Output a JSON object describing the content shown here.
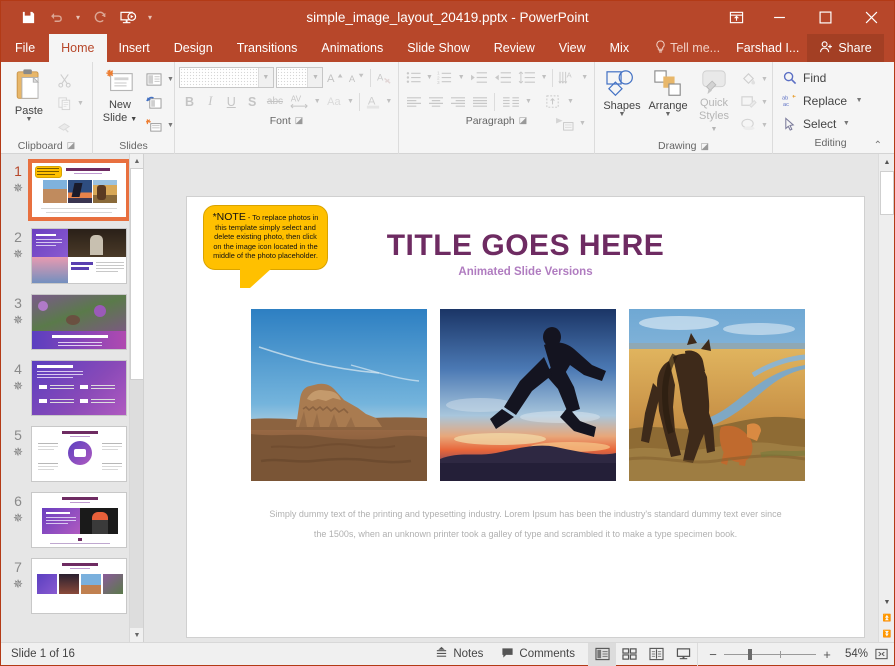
{
  "titlebar": {
    "document_name": "simple_image_layout_20419.pptx - PowerPoint",
    "qat": [
      {
        "name": "save",
        "icon": "save-icon",
        "enabled": true
      },
      {
        "name": "undo",
        "icon": "undo-icon",
        "enabled": false
      },
      {
        "name": "redo",
        "icon": "redo-icon",
        "enabled": false
      },
      {
        "name": "start-presentation",
        "icon": "present-icon",
        "enabled": true
      },
      {
        "name": "customize-qat",
        "icon": "chevron-down-icon",
        "enabled": true
      }
    ],
    "window": {
      "ribbon_display_options": "ribbon-options-icon",
      "minimize": "minimize-icon",
      "maximize": "maximize-icon",
      "close": "close-icon"
    }
  },
  "tabs": [
    {
      "label": "File",
      "active": false
    },
    {
      "label": "Home",
      "active": true
    },
    {
      "label": "Insert",
      "active": false
    },
    {
      "label": "Design",
      "active": false
    },
    {
      "label": "Transitions",
      "active": false
    },
    {
      "label": "Animations",
      "active": false
    },
    {
      "label": "Slide Show",
      "active": false
    },
    {
      "label": "Review",
      "active": false
    },
    {
      "label": "View",
      "active": false
    },
    {
      "label": "Mix",
      "active": false
    }
  ],
  "tellme": "Tell me...",
  "username": "Farshad I...",
  "share": "Share",
  "ribbon": {
    "groups": [
      {
        "name": "Clipboard",
        "has_dialog_launcher": true
      },
      {
        "name": "Slides",
        "has_dialog_launcher": false
      },
      {
        "name": "Font",
        "has_dialog_launcher": true
      },
      {
        "name": "Paragraph",
        "has_dialog_launcher": true
      },
      {
        "name": "Drawing",
        "has_dialog_launcher": true
      },
      {
        "name": "Editing",
        "has_dialog_launcher": false
      }
    ],
    "clipboard": {
      "paste": "Paste",
      "cut_tooltip": "Cut",
      "copy_tooltip": "Copy",
      "format_painter_tooltip": "Format Painter"
    },
    "slides": {
      "new_slide": "New\nSlide",
      "new_slide_line1": "New",
      "new_slide_line2": "Slide",
      "layout_tooltip": "Layout",
      "reset_tooltip": "Reset",
      "section_tooltip": "Section"
    },
    "font": {
      "font_family_value": "",
      "font_size_value": "",
      "bold": "B",
      "italic": "I",
      "underline": "U",
      "shadow": "S",
      "strikethrough": "abc",
      "character_spacing": "AV",
      "change_case": "Aa",
      "font_color": "A",
      "increase_size": "A",
      "decrease_size": "A",
      "clear_formatting_tooltip": "Clear All Formatting"
    },
    "paragraph": {
      "bullets_tooltip": "Bullets",
      "numbering_tooltip": "Numbering",
      "decrease_indent_tooltip": "Decrease List Level",
      "increase_indent_tooltip": "Increase List Level",
      "line_spacing_tooltip": "Line Spacing",
      "text_direction_tooltip": "Text Direction",
      "align_text_tooltip": "Align Text",
      "smartart_tooltip": "Convert to SmartArt",
      "align_left_tooltip": "Align Left",
      "center_tooltip": "Center",
      "align_right_tooltip": "Align Right",
      "justify_tooltip": "Justify",
      "columns_tooltip": "Columns"
    },
    "drawing": {
      "shapes": "Shapes",
      "arrange": "Arrange",
      "quick_styles_line1": "Quick",
      "quick_styles_line2": "Styles",
      "shape_fill_tooltip": "Shape Fill",
      "shape_outline_tooltip": "Shape Outline",
      "shape_effects_tooltip": "Shape Effects"
    },
    "editing": {
      "find": "Find",
      "replace": "Replace",
      "select": "Select"
    },
    "collapse_ribbon": "collapse-ribbon-icon"
  },
  "slide_panel": {
    "slides": [
      {
        "number": "1",
        "active": true,
        "has_animation": true
      },
      {
        "number": "2",
        "active": false,
        "has_animation": true
      },
      {
        "number": "3",
        "active": false,
        "has_animation": true
      },
      {
        "number": "4",
        "active": false,
        "has_animation": true
      },
      {
        "number": "5",
        "active": false,
        "has_animation": true
      },
      {
        "number": "6",
        "active": false,
        "has_animation": true
      },
      {
        "number": "7",
        "active": false,
        "has_animation": true
      }
    ]
  },
  "slide": {
    "note": {
      "heading": "*NOTE",
      "body": " - To replace photos in this template simply select and delete existing photo, then click on the image icon located in the middle of the photo placeholder."
    },
    "title": "TITLE GOES HERE",
    "subtitle": "Animated Slide Versions",
    "body": "Simply dummy text of the printing and typesetting industry. Lorem Ipsum has been the industry's standard dummy text ever since the 1500s, when an unknown printer took a galley of type and scrambled it to make a type specimen book.",
    "photos": [
      {
        "name": "desert-butte-photo",
        "alt": "Desert butte under blue sky"
      },
      {
        "name": "jumping-silhouette-photo",
        "alt": "Silhouette of person jumping at sunset"
      },
      {
        "name": "icelandic-horses-photo",
        "alt": "Horses in golden field"
      }
    ],
    "colors": {
      "title": "#6E2B62",
      "subtitle": "#B07CC0",
      "note_bg": "#FFC000"
    }
  },
  "status": {
    "slide_counter": "Slide 1 of 16",
    "notes": "Notes",
    "comments": "Comments",
    "views": [
      {
        "name": "normal-view",
        "active": true
      },
      {
        "name": "slide-sorter-view",
        "active": false
      },
      {
        "name": "reading-view",
        "active": false
      },
      {
        "name": "slide-show-view",
        "active": false
      }
    ],
    "zoom_out": "−",
    "zoom_in": "+",
    "zoom_level": "54%",
    "fit_to_window": "fit-slide-icon"
  }
}
